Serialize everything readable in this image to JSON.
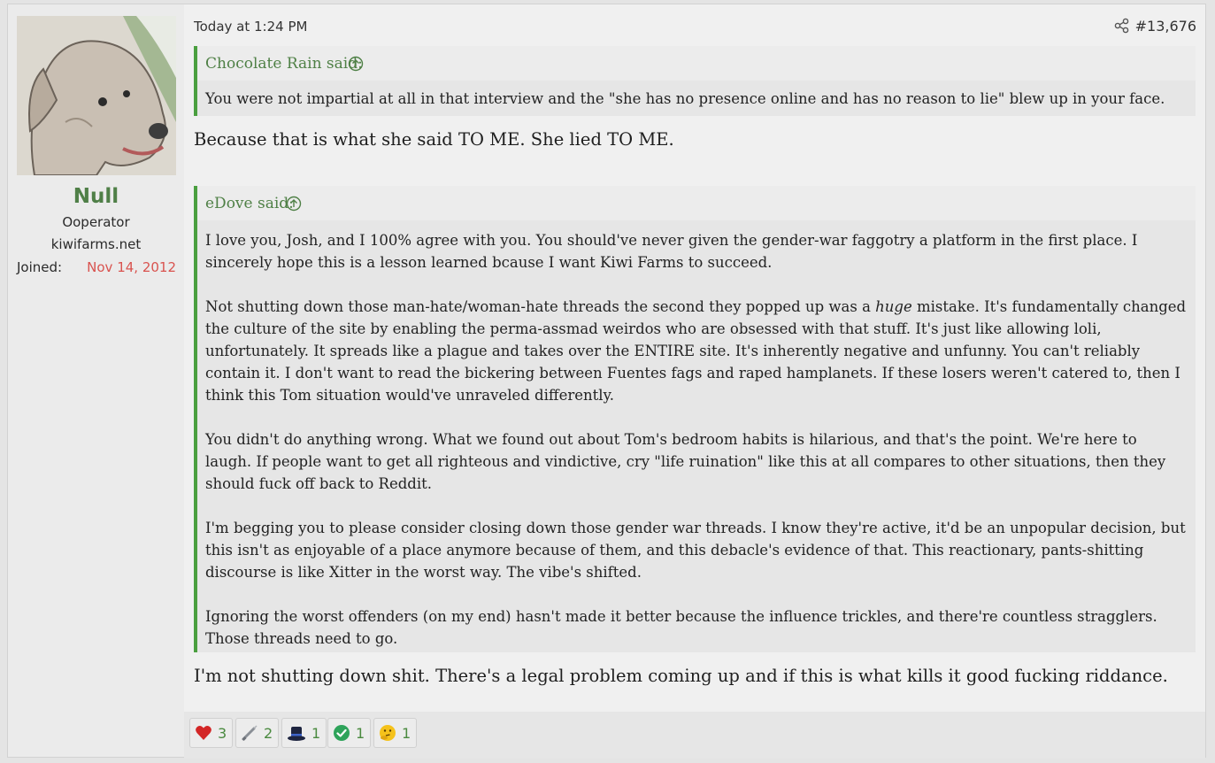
{
  "user": {
    "name": "Null",
    "title": "Ooperator",
    "site": "kiwifarms.net",
    "joined_label": "Joined:",
    "joined_value": "Nov 14, 2012"
  },
  "post": {
    "date": "Today at 1:24 PM",
    "number": "#13,676",
    "quote1": {
      "author": "Chocolate Rain said:",
      "text": "You were not impartial at all in that interview and the \"she has no presence online and has no reason to lie\" blew up in your face."
    },
    "reply1": "Because that is what she said TO ME. She lied TO ME.",
    "quote2": {
      "author": "eDove said:",
      "p1": "I love you, Josh, and I 100% agree with you. You should've never given the gender-war faggotry a platform in the first place. I sincerely hope this is a lesson learned bcause I want Kiwi Farms to succeed.",
      "p2_a": "Not shutting down those man-hate/woman-hate threads the second they popped up was a ",
      "p2_em": "huge",
      "p2_b": " mistake. It's fundamentally changed the culture of the site by enabling the perma-assmad weirdos who are obsessed with that stuff. It's just like allowing loli, unfortunately. It spreads like a plague and takes over the ENTIRE site. It's inherently negative and unfunny. You can't reliably contain it. I don't want to read the bickering between Fuentes fags and raped hamplanets. If these losers weren't catered to, then I think this Tom situation would've unraveled differently.",
      "p3": "You didn't do anything wrong. What we found out about Tom's bedroom habits is hilarious, and that's the point. We're here to laugh. If people want to get all righteous and vindictive, cry \"life ruination\" like this at all compares to other situations, then they should fuck off back to Reddit.",
      "p4": "I'm begging you to please consider closing down those gender war threads. I know they're active, it'd be an unpopular decision, but this isn't as enjoyable of a place anymore because of them, and this debacle's evidence of that. This reactionary, pants-shitting discourse is like Xitter in the worst way. The vibe's shifted.",
      "p5": "Ignoring the worst offenders (on my end) hasn't made it better because the influence trickles, and there're countless stragglers. Those threads need to go."
    },
    "reply2": "I'm not shutting down shit. There's a legal problem coming up and if this is what kills it good fucking riddance."
  },
  "reactions": [
    {
      "icon": "heart-icon",
      "count": "3"
    },
    {
      "icon": "needle-icon",
      "count": "2"
    },
    {
      "icon": "top-hat-icon",
      "count": "1"
    },
    {
      "icon": "check-icon",
      "count": "1"
    },
    {
      "icon": "thinking-face-icon",
      "count": "1"
    }
  ],
  "colors": {
    "accent_green": "#4a9f3f",
    "username_green": "#4f7f47",
    "joined_red": "#d9534f"
  }
}
